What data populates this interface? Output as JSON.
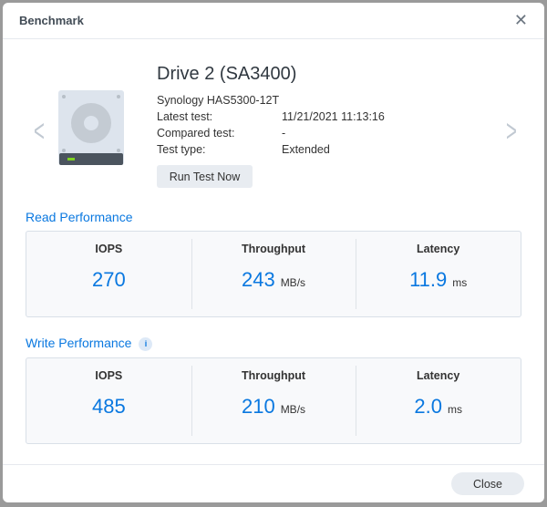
{
  "dialog": {
    "title": "Benchmark"
  },
  "drive": {
    "name": "Drive 2 (SA3400)",
    "model": "Synology HAS5300-12T",
    "rows": [
      {
        "label": "Latest test:",
        "value": "11/21/2021 11:13:16"
      },
      {
        "label": "Compared test:",
        "value": "-"
      },
      {
        "label": "Test type:",
        "value": "Extended"
      }
    ],
    "run_label": "Run Test Now"
  },
  "read": {
    "title": "Read Performance",
    "metrics": [
      {
        "label": "IOPS",
        "value": "270",
        "unit": ""
      },
      {
        "label": "Throughput",
        "value": "243",
        "unit": "MB/s"
      },
      {
        "label": "Latency",
        "value": "11.9",
        "unit": "ms"
      }
    ]
  },
  "write": {
    "title": "Write Performance",
    "info": "i",
    "metrics": [
      {
        "label": "IOPS",
        "value": "485",
        "unit": ""
      },
      {
        "label": "Throughput",
        "value": "210",
        "unit": "MB/s"
      },
      {
        "label": "Latency",
        "value": "2.0",
        "unit": "ms"
      }
    ]
  },
  "footer": {
    "close_label": "Close"
  }
}
